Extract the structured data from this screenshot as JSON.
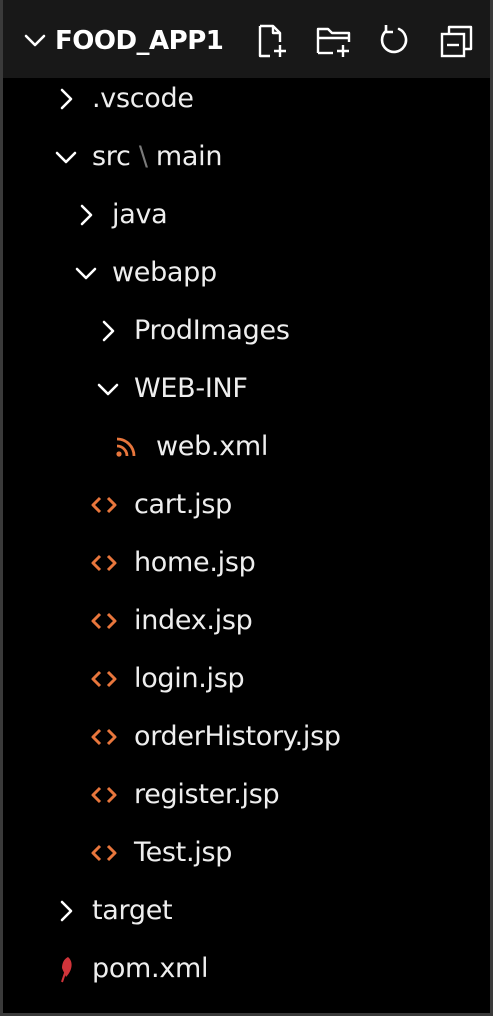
{
  "explorer": {
    "title": "FOOD_APP1",
    "tools": {
      "new_file": "new-file-icon",
      "new_folder": "new-folder-icon",
      "refresh": "refresh-icon",
      "collapse_all": "collapse-all-icon"
    }
  },
  "colors": {
    "jsp_icon": "#e8763c",
    "xml_icon": "#e8763c",
    "pom_icon": "#d1343a",
    "text": "#eeeeee",
    "background": "#000000",
    "header_bg": "#181818"
  },
  "tree": {
    "vscode": ".vscode",
    "src_part1": "src",
    "src_sep": "\\",
    "src_part2": "main",
    "java": "java",
    "webapp": "webapp",
    "prodimages": "ProdImages",
    "webinf": "WEB-INF",
    "webxml": "web.xml",
    "files": [
      "cart.jsp",
      "home.jsp",
      "index.jsp",
      "login.jsp",
      "orderHistory.jsp",
      "register.jsp",
      "Test.jsp"
    ],
    "target": "target",
    "pom": "pom.xml"
  }
}
